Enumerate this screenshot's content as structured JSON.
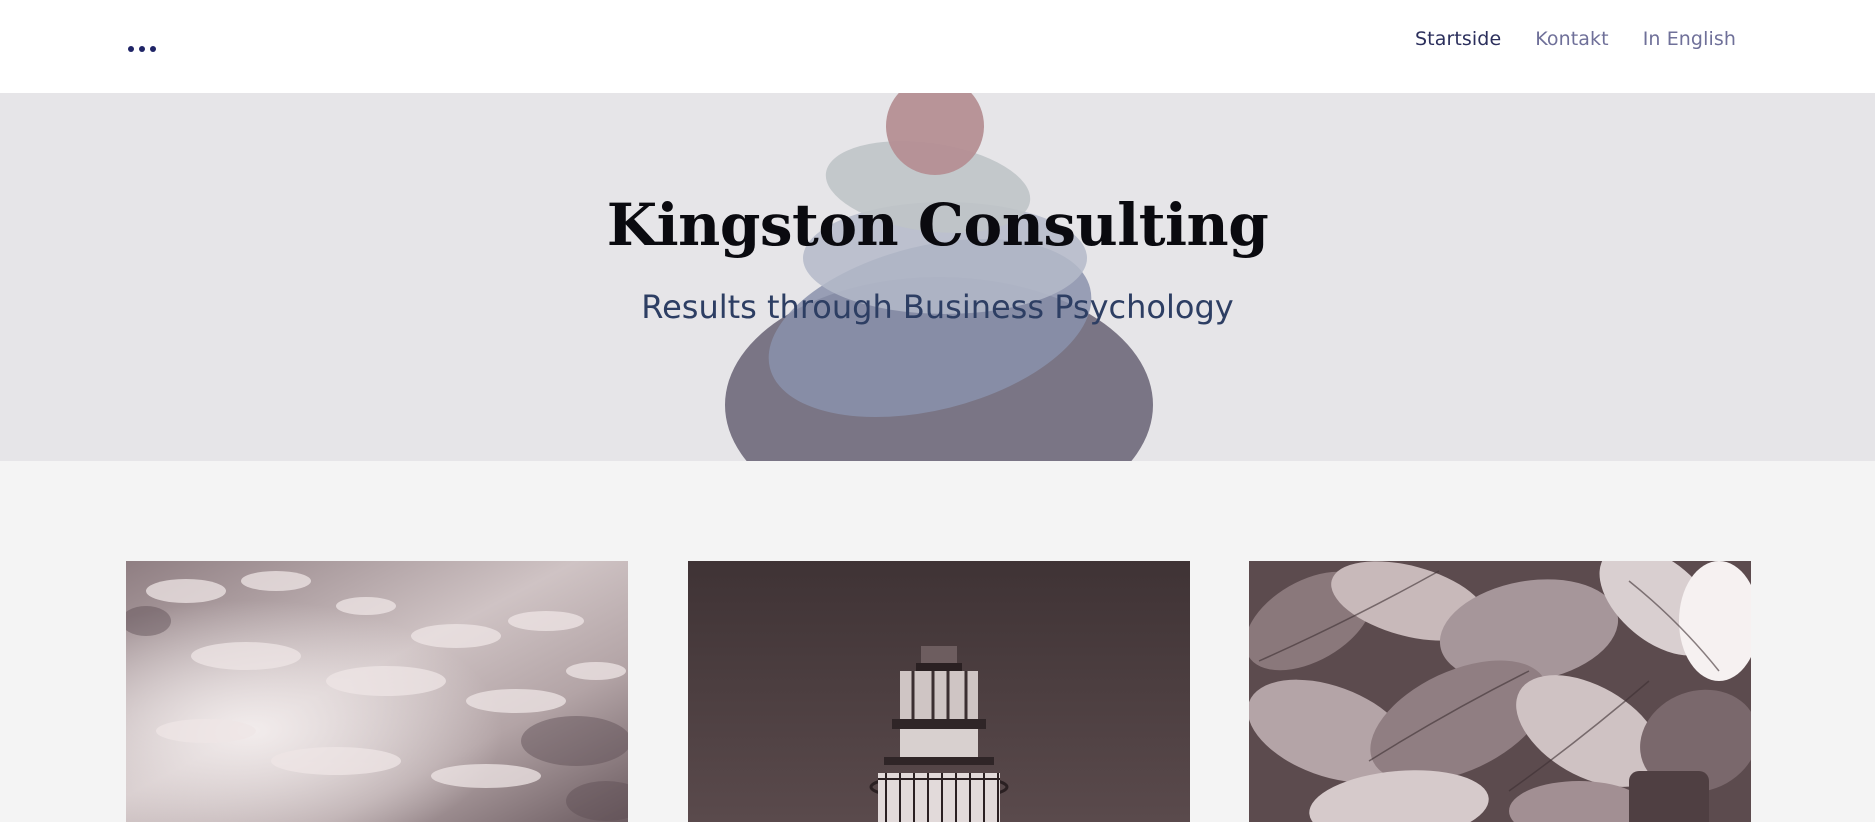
{
  "header": {
    "menu_icon": "more-dots-icon",
    "nav": [
      {
        "label": "Startside",
        "active": true
      },
      {
        "label": "Kontakt",
        "active": false
      },
      {
        "label": "In English",
        "active": false
      }
    ]
  },
  "hero": {
    "title": "Kingston Consulting",
    "subtitle": "Results through Business Psychology",
    "background_color": "#e6e5e8",
    "image": "stacked-stones-illustration"
  },
  "cards": [
    {
      "image": "cloudy-sky-photo"
    },
    {
      "image": "lighthouse-photo"
    },
    {
      "image": "hosta-leaves-photo"
    }
  ],
  "colors": {
    "nav_text": "#6f7099",
    "nav_active": "#2b2f5c",
    "title": "#0a0a0f",
    "subtitle": "#2d3e63",
    "page_background": "#f4f4f4"
  }
}
